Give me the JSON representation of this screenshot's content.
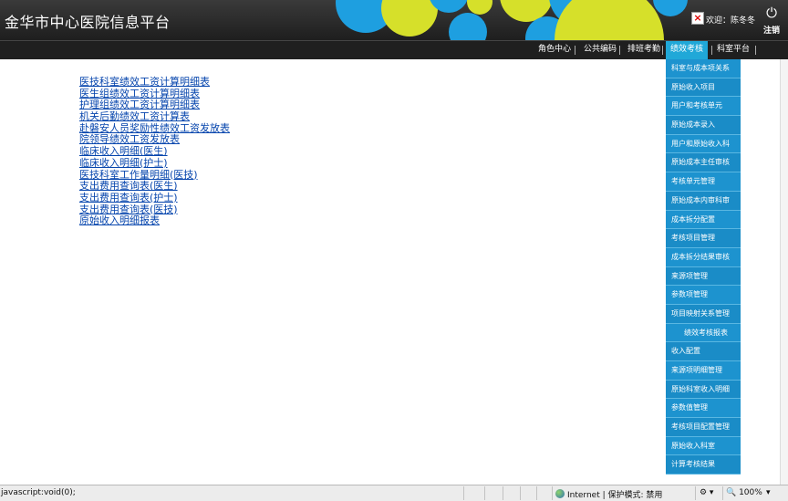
{
  "header": {
    "app_title": "金华市中心医院信息平台",
    "welcome": "欢迎：陈冬冬",
    "logout_label": "注销",
    "logout_icon": "power-icon",
    "broken_image_icon": "broken-image-icon"
  },
  "nav": {
    "items": [
      "角色中心",
      "公共编码",
      "排班考勤",
      "绩效考核",
      "科室平台"
    ],
    "active_index": 3,
    "active_color": "#20a8d8"
  },
  "report_links": [
    "医技科室绩效工资计算明细表",
    "医生组绩效工资计算明细表",
    "护理组绩效工资计算明细表",
    "机关后勤绩效工资计算表",
    "赴磐安人员奖励性绩效工资发放表",
    "院领导绩效工资发放表",
    "临床收入明细(医生)",
    "临床收入明细(护士)",
    "医技科室工作量明细(医技)",
    "支出费用查询表(医生)",
    "支出费用查询表(护士)",
    "支出费用查询表(医技)",
    "原始收入明细报表"
  ],
  "dropdown": {
    "color": "#1d93cf",
    "items": [
      "科室与成本项关系",
      "原始收入项目",
      "用户和考核单元",
      "原始成本录入",
      "用户和原始收入科",
      "原始成本主任审核",
      "考核单元管理",
      "原始成本内审科审",
      "成本拆分配置",
      "考核项目管理",
      "成本拆分结果审核",
      "来源项管理",
      "参数项管理",
      "项目映射关系管理",
      "绩效考核报表",
      "收入配置",
      "来源项明细管理",
      "原始科室收入明细",
      "参数值管理",
      "考核项目配置管理",
      "原始收入科室",
      "计算考核结果"
    ],
    "indented_index": 14
  },
  "status": {
    "text": "javascript:void(0);",
    "zone": "Internet | 保护模式: 禁用",
    "zoom": "100%",
    "globe_icon": "globe-icon",
    "tools_icon": "tools-icon"
  }
}
